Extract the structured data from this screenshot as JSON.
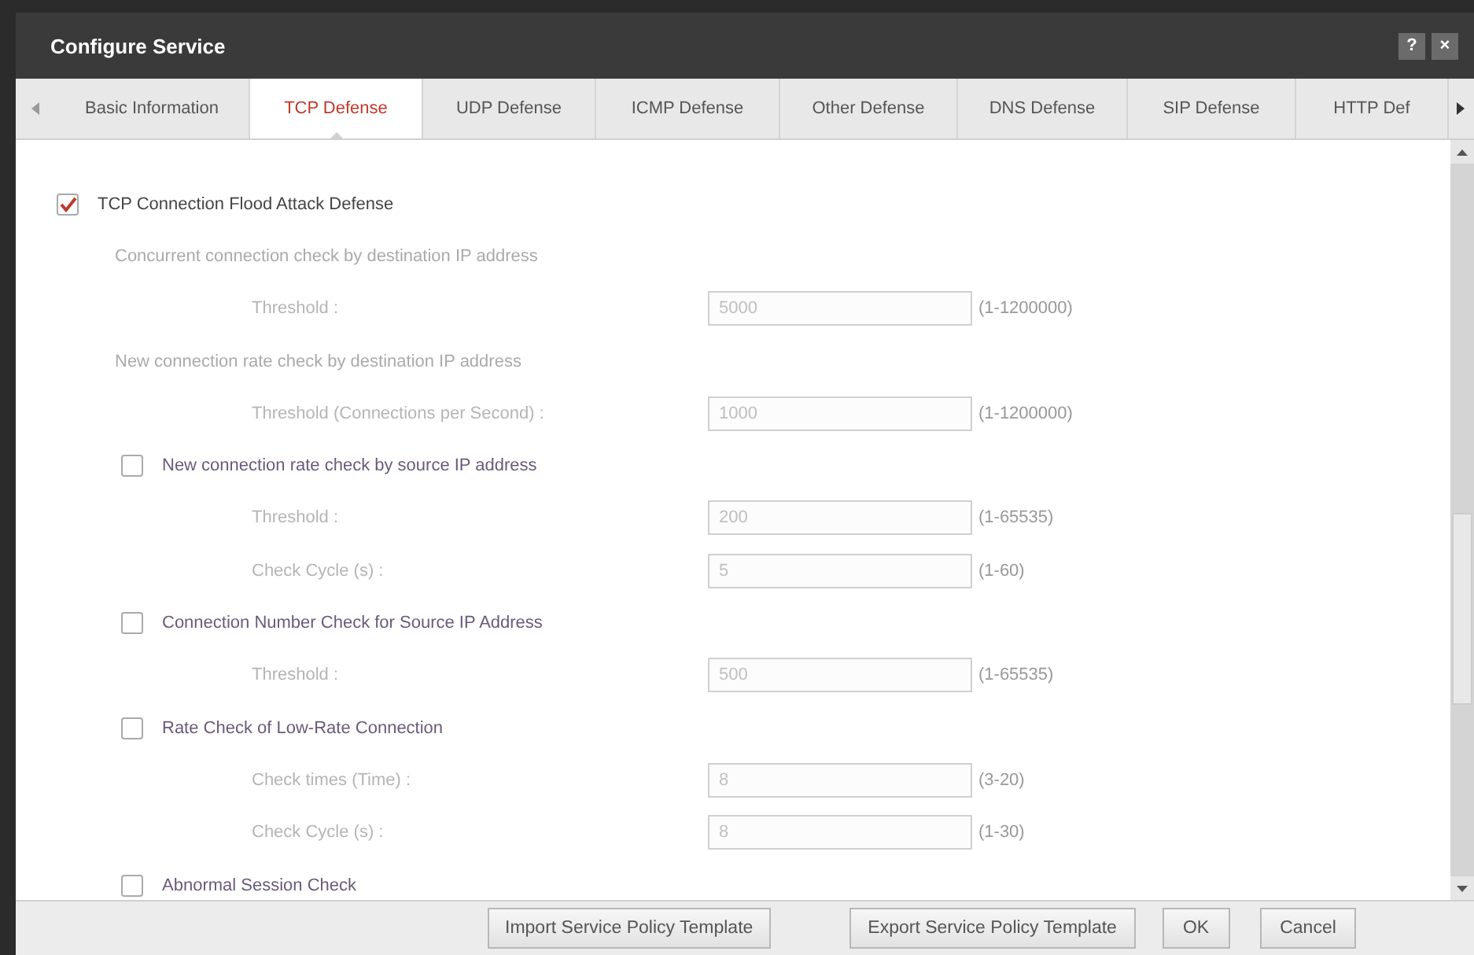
{
  "window": {
    "title": "Configure Service",
    "help_button": "?",
    "close_button": "×"
  },
  "tabs": [
    {
      "label": "Basic Information",
      "selected": false
    },
    {
      "label": "TCP Defense",
      "selected": true
    },
    {
      "label": "UDP Defense",
      "selected": false
    },
    {
      "label": "ICMP Defense",
      "selected": false
    },
    {
      "label": "Other Defense",
      "selected": false
    },
    {
      "label": "DNS Defense",
      "selected": false
    },
    {
      "label": "SIP Defense",
      "selected": false
    },
    {
      "label": "HTTP Def",
      "selected": false
    }
  ],
  "items": [
    {
      "kind": "checkbox",
      "label": "TCP Connection Flood Attack Defense",
      "checked": true,
      "indent": false
    },
    {
      "kind": "heading",
      "label": "Concurrent connection check by destination IP address"
    },
    {
      "kind": "field",
      "label": "Threshold :",
      "value": "5000",
      "range": "(1-1200000)",
      "disabled": true
    },
    {
      "kind": "heading",
      "label": "New connection rate check by destination IP address"
    },
    {
      "kind": "field",
      "label": "Threshold (Connections per Second) :",
      "value": "1000",
      "range": "(1-1200000)",
      "disabled": true
    },
    {
      "kind": "checkbox",
      "label": "New connection rate check by source IP address",
      "checked": false,
      "indent": true
    },
    {
      "kind": "field",
      "label": "Threshold :",
      "value": "200",
      "range": "(1-65535)",
      "disabled": true
    },
    {
      "kind": "field",
      "label": "Check Cycle (s) :",
      "value": "5",
      "range": "(1-60)",
      "disabled": true
    },
    {
      "kind": "checkbox",
      "label": "Connection Number Check for Source IP Address",
      "checked": false,
      "indent": true
    },
    {
      "kind": "field",
      "label": "Threshold :",
      "value": "500",
      "range": "(1-65535)",
      "disabled": true
    },
    {
      "kind": "checkbox",
      "label": "Rate Check of Low-Rate Connection",
      "checked": false,
      "indent": true
    },
    {
      "kind": "field",
      "label": "Check times (Time) :",
      "value": "8",
      "range": "(3-20)",
      "disabled": true
    },
    {
      "kind": "field",
      "label": "Check Cycle (s) :",
      "value": "8",
      "range": "(1-30)",
      "disabled": true
    },
    {
      "kind": "checkbox",
      "label": "Abnormal Session Check",
      "checked": false,
      "indent": true
    }
  ],
  "buttons": [
    "Import Service Policy Template",
    "Export Service Policy Template",
    "OK",
    "Cancel"
  ]
}
